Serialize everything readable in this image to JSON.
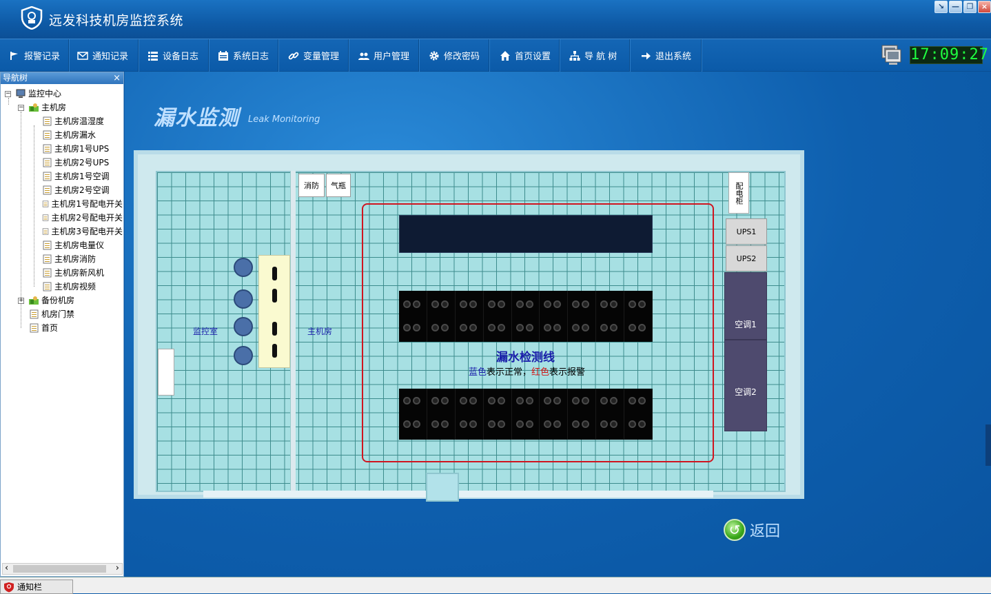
{
  "app": {
    "title": "远发科技机房监控系统",
    "clock": "17:09:27"
  },
  "window_controls": {
    "min_label": "↘",
    "dash_label": "—",
    "restore_label": "❐",
    "close_label": "×"
  },
  "menu": [
    {
      "label": "报警记录",
      "icon": "flag-icon"
    },
    {
      "label": "通知记录",
      "icon": "mail-icon"
    },
    {
      "label": "设备日志",
      "icon": "list-icon"
    },
    {
      "label": "系统日志",
      "icon": "calendar-icon"
    },
    {
      "label": "变量管理",
      "icon": "link-icon"
    },
    {
      "label": "用户管理",
      "icon": "users-icon"
    },
    {
      "label": "修改密码",
      "icon": "gear-icon"
    },
    {
      "label": "首页设置",
      "icon": "home-icon"
    },
    {
      "label": "导 航 树",
      "icon": "tree-icon"
    },
    {
      "label": "退出系统",
      "icon": "arrow-right-icon"
    }
  ],
  "sidebar": {
    "title": "导航树",
    "close": "×",
    "tree": [
      {
        "label": "监控中心",
        "level": 0
      },
      {
        "label": "主机房",
        "level": 1
      },
      {
        "label": "主机房温湿度",
        "level": 2
      },
      {
        "label": "主机房漏水",
        "level": 2
      },
      {
        "label": "主机房1号UPS",
        "level": 2
      },
      {
        "label": "主机房2号UPS",
        "level": 2
      },
      {
        "label": "主机房1号空调",
        "level": 2
      },
      {
        "label": "主机房2号空调",
        "level": 2
      },
      {
        "label": "主机房1号配电开关",
        "level": 2
      },
      {
        "label": "主机房2号配电开关",
        "level": 2
      },
      {
        "label": "主机房3号配电开关",
        "level": 2
      },
      {
        "label": "主机房电量仪",
        "level": 2
      },
      {
        "label": "主机房消防",
        "level": 2
      },
      {
        "label": "主机房新风机",
        "level": 2
      },
      {
        "label": "主机房视频",
        "level": 2
      },
      {
        "label": "备份机房",
        "level": 1
      },
      {
        "label": "机房门禁",
        "level": 1
      },
      {
        "label": "首页",
        "level": 1
      }
    ],
    "expanders": {
      "root": "−",
      "main": "−",
      "backup": "+"
    },
    "scroll_left": "‹",
    "scroll_right": "›"
  },
  "main": {
    "title": "漏水监测",
    "subtitle": "Leak Monitoring",
    "room": {
      "monitor_room": "监控室",
      "main_room": "主机房",
      "fire": "消防",
      "gas": "气瓶",
      "distribution": "配电柜",
      "ups1": "UPS1",
      "ups2": "UPS2",
      "ac1": "空调1",
      "ac2": "空调2",
      "leak_title": "漏水检测线",
      "legend_blue": "蓝色",
      "legend_mid": "表示正常，",
      "legend_red": "红色",
      "legend_end": "表示报警"
    },
    "back": "返回",
    "colors": {
      "leak_line": "#d0141f",
      "normal": "#1a1eaa",
      "alarm": "#d01414"
    }
  },
  "status": {
    "notify_tab": "通知栏"
  }
}
